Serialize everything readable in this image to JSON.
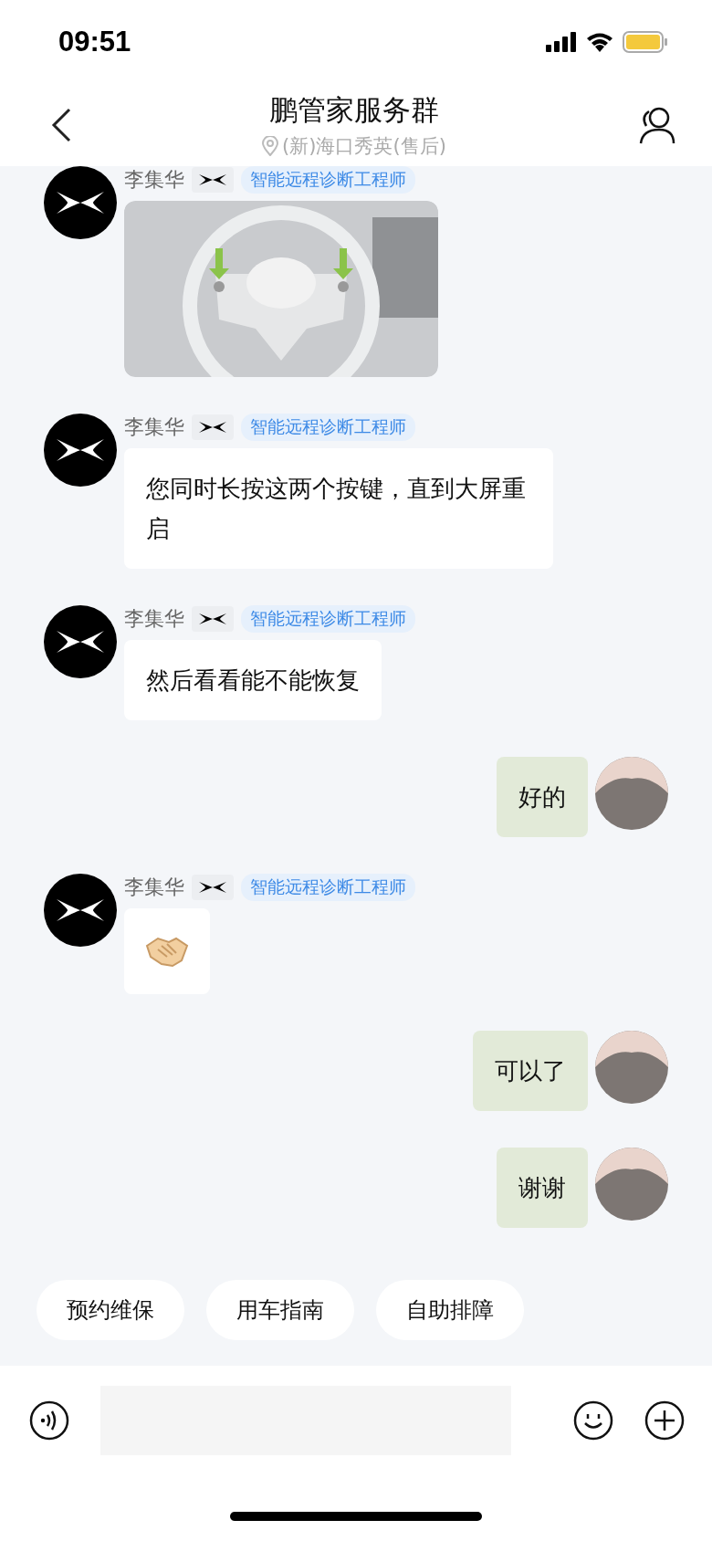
{
  "status_bar": {
    "time": "09:51"
  },
  "header": {
    "title": "鹏管家服务群",
    "subtitle": "(新)海口秀英(售后)"
  },
  "messages": [
    {
      "outgoing": false,
      "name": "李集华",
      "badge": "智能远程诊断工程师",
      "kind": "image"
    },
    {
      "outgoing": false,
      "name": "李集华",
      "badge": "智能远程诊断工程师",
      "kind": "text",
      "text": "您同时长按这两个按键，直到大屏重启"
    },
    {
      "outgoing": false,
      "name": "李集华",
      "badge": "智能远程诊断工程师",
      "kind": "text",
      "text": "然后看看能不能恢复"
    },
    {
      "outgoing": true,
      "kind": "text",
      "text": "好的"
    },
    {
      "outgoing": false,
      "name": "李集华",
      "badge": "智能远程诊断工程师",
      "kind": "sticker"
    },
    {
      "outgoing": true,
      "kind": "text",
      "text": "可以了"
    },
    {
      "outgoing": true,
      "kind": "text",
      "text": "谢谢"
    }
  ],
  "quick_actions": [
    "预约维保",
    "用车指南",
    "自助排障"
  ]
}
